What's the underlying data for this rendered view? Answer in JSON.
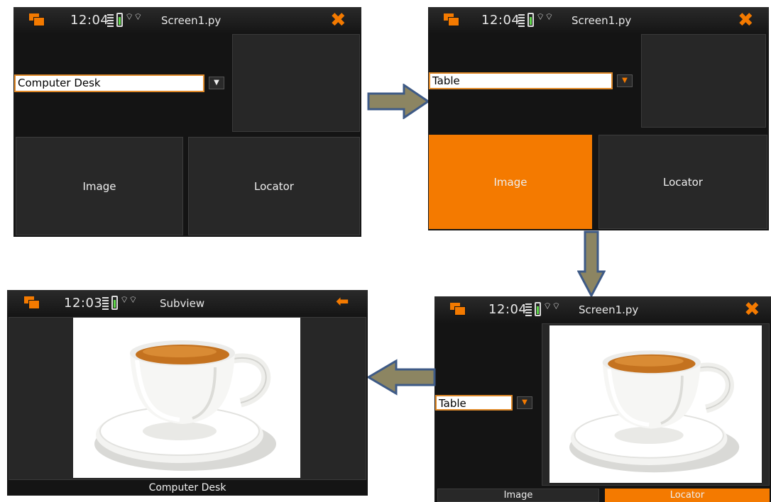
{
  "screen1": {
    "time": "12:04",
    "title": "Screen1.py",
    "close_icon": "✖",
    "combo_value": "Computer Desk",
    "tile_image": "Image",
    "tile_locator": "Locator"
  },
  "screen2": {
    "time": "12:04",
    "title": "Screen1.py",
    "close_icon": "✖",
    "combo_value": "Table",
    "tile_image": "Image",
    "tile_locator": "Locator"
  },
  "screen3": {
    "time": "12:04",
    "title": "Screen1.py",
    "close_icon": "✖",
    "combo_value": "Table",
    "tile_image": "Image",
    "tile_locator": "Locator"
  },
  "screen4": {
    "time": "12:03",
    "title": "Subview",
    "back_icon": "⬅",
    "caption": "Computer Desk"
  },
  "colors": {
    "accent": "#f47a00",
    "arrow_fill": "#8c8562",
    "arrow_stroke": "#3e5a86",
    "screen_bg": "#141414",
    "tile_bg": "#282828"
  },
  "icons": {
    "apps": "apps-icon",
    "signal": "signal-icon",
    "battery": "battery-icon",
    "wifi": "wifi-icon",
    "close": "close-icon",
    "back": "back-arrow-icon",
    "dropdown": "chevron-down-icon",
    "photo": "teacup-photo"
  }
}
